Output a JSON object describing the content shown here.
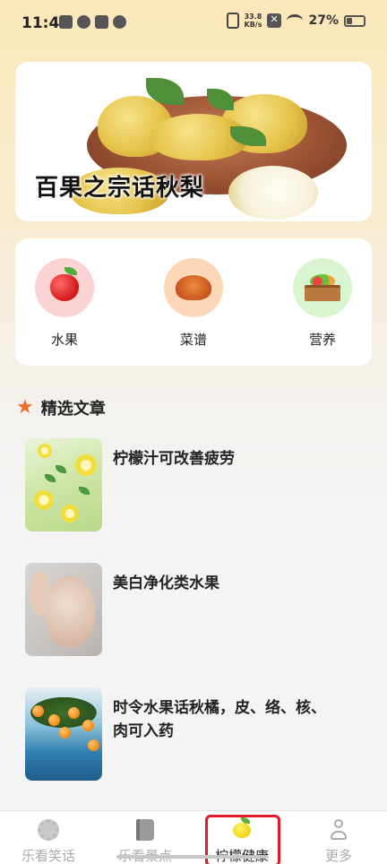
{
  "status_bar": {
    "time": "11:47",
    "net_speed_value": "33.8",
    "net_speed_unit": "KB/s",
    "battery": "27%"
  },
  "banner": {
    "title": "百果之宗话秋梨"
  },
  "categories": [
    {
      "label": "水果",
      "icon": "apple-icon",
      "color": "#fbd3d3"
    },
    {
      "label": "菜谱",
      "icon": "dish-icon",
      "color": "#fbd7b8"
    },
    {
      "label": "营养",
      "icon": "vegetable-crate-icon",
      "color": "#d8f5cf"
    }
  ],
  "section": {
    "title": "精选文章",
    "icon": "star-icon",
    "icon_color": "#f06a2a"
  },
  "articles": [
    {
      "title": "柠檬汁可改善疲劳",
      "thumb": "lemon-water-image"
    },
    {
      "title": "美白净化类水果",
      "thumb": "woman-face-image"
    },
    {
      "title": "时令水果话秋橘，皮、络、核、肉可入药",
      "thumb": "orange-tree-image"
    }
  ],
  "bottom_nav": {
    "items": [
      {
        "label": "乐看笑话",
        "icon": "gear-icon"
      },
      {
        "label": "乐看景点",
        "icon": "book-icon"
      },
      {
        "label": "柠檬健康",
        "icon": "lemon-icon",
        "active": true
      },
      {
        "label": "更多",
        "icon": "person-icon"
      }
    ],
    "highlight_color": "#e01a2a"
  }
}
